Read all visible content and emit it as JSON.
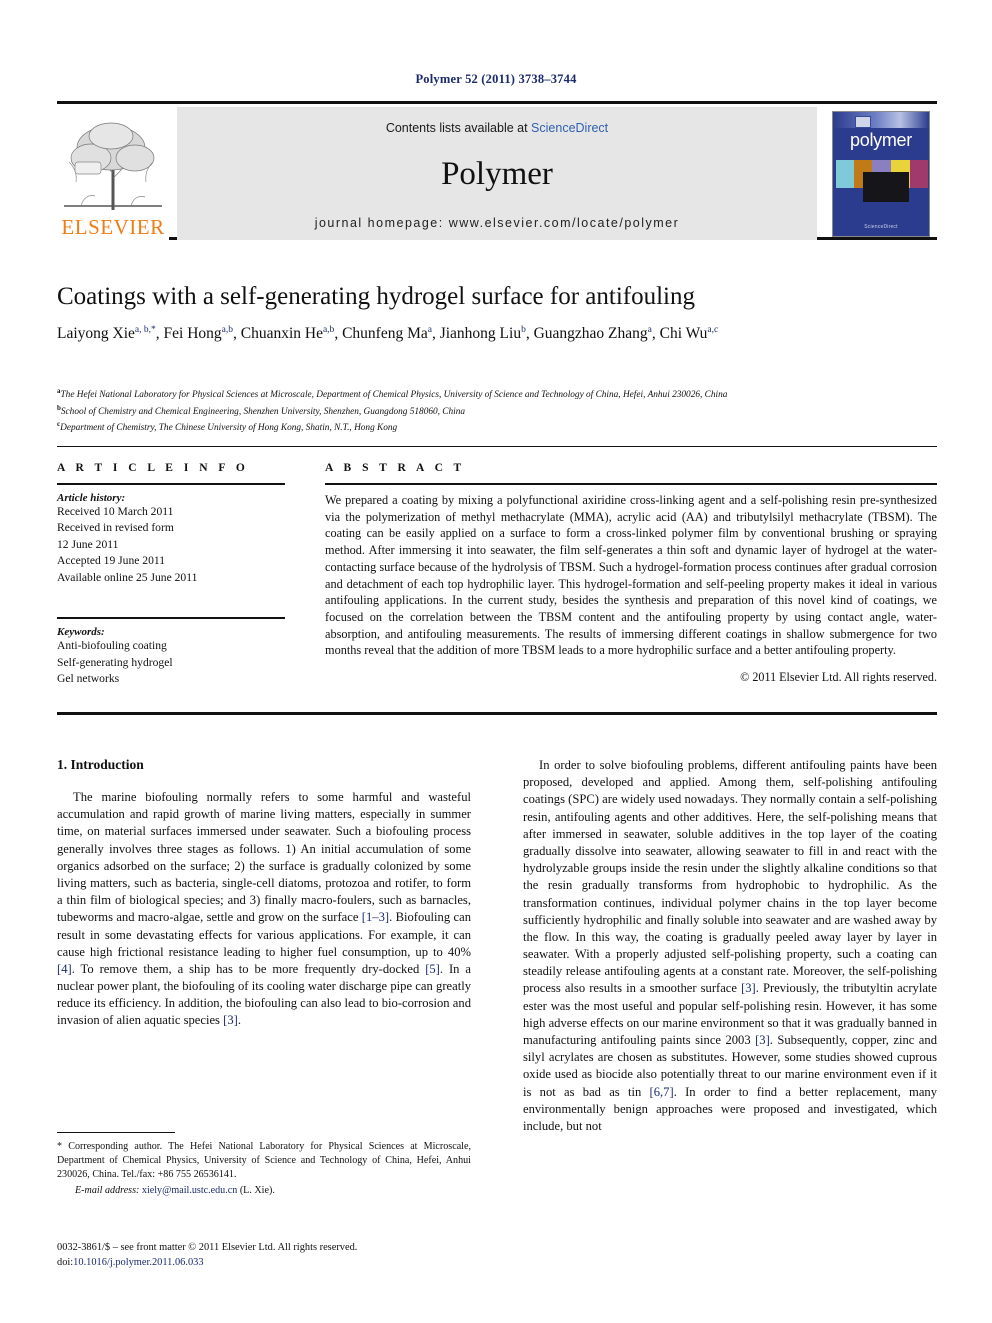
{
  "running_head": "Polymer 52 (2011) 3738–3744",
  "masthead": {
    "publisher": "ELSEVIER",
    "contents_prefix": "Contents lists available at ",
    "contents_link": "ScienceDirect",
    "journal_title": "Polymer",
    "homepage": "journal homepage: www.elsevier.com/locate/polymer",
    "cover_name": "polymer",
    "cover_footer": "ScienceDirect",
    "link_color": "#2f5fb0",
    "elsevier_orange": "#f07c15"
  },
  "article": {
    "title": "Coatings with a self-generating hydrogel surface for antifouling",
    "authors": [
      {
        "name": "Laiyong Xie",
        "sup": "a, b,*"
      },
      {
        "name": "Fei Hong",
        "sup": "a,b"
      },
      {
        "name": "Chuanxin He",
        "sup": "a,b"
      },
      {
        "name": "Chunfeng Ma",
        "sup": "a"
      },
      {
        "name": "Jianhong Liu",
        "sup": "b"
      },
      {
        "name": "Guangzhao Zhang",
        "sup": "a"
      },
      {
        "name": "Chi Wu",
        "sup": "a,c"
      }
    ],
    "affiliations": [
      {
        "marker": "a",
        "text": "The Hefei National Laboratory for Physical Sciences at Microscale, Department of Chemical Physics, University of Science and Technology of China, Hefei, Anhui 230026, China"
      },
      {
        "marker": "b",
        "text": "School of Chemistry and Chemical Engineering, Shenzhen University, Shenzhen, Guangdong 518060, China"
      },
      {
        "marker": "c",
        "text": "Department of Chemistry, The Chinese University of Hong Kong, Shatin, N.T., Hong Kong"
      }
    ]
  },
  "article_info": {
    "heading": "A R T I C L E   I N F O",
    "history_label": "Article history:",
    "history": [
      "Received 10 March 2011",
      "Received in revised form",
      "12 June 2011",
      "Accepted 19 June 2011",
      "Available online 25 June 2011"
    ],
    "keywords_label": "Keywords:",
    "keywords": [
      "Anti-biofouling coating",
      "Self-generating hydrogel",
      "Gel networks"
    ]
  },
  "abstract": {
    "heading": "A B S T R A C T",
    "text": "We prepared a coating by mixing a polyfunctional axiridine cross-linking agent and a self-polishing resin pre-synthesized via the polymerization of methyl methacrylate (MMA), acrylic acid (AA) and tributylsilyl methacrylate (TBSM). The coating can be easily applied on a surface to form a cross-linked polymer film by conventional brushing or spraying method. After immersing it into seawater, the film self-generates a thin soft and dynamic layer of hydrogel at the water-contacting surface because of the hydrolysis of TBSM. Such a hydrogel-formation process continues after gradual corrosion and detachment of each top hydrophilic layer. This hydrogel-formation and self-peeling property makes it ideal in various antifouling applications. In the current study, besides the synthesis and preparation of this novel kind of coatings, we focused on the correlation between the TBSM content and the antifouling property by using contact angle, water-absorption, and antifouling measurements. The results of immersing different coatings in shallow submergence for two months reveal that the addition of more TBSM leads to a more hydrophilic surface and a better antifouling property.",
    "copyright": "© 2011 Elsevier Ltd. All rights reserved."
  },
  "body": {
    "section_heading": "1. Introduction",
    "left_paragraphs": [
      "The marine biofouling normally refers to some harmful and wasteful accumulation and rapid growth of marine living matters, especially in summer time, on material surfaces immersed under seawater. Such a biofouling process generally involves three stages as follows. 1) An initial accumulation of some organics adsorbed on the surface; 2) the surface is gradually colonized by some living matters, such as bacteria, single-cell diatoms, protozoa and rotifer, to form a thin film of biological species; and 3) finally macro-foulers, such as barnacles, tubeworms and macro-algae, settle and grow on the surface [1–3]. Biofouling can result in some devastating effects for various applications. For example, it can cause high frictional resistance leading to higher fuel consumption, up to 40% [4]. To remove them, a ship has to be more frequently dry-docked [5]. In a nuclear power plant, the biofouling of its cooling water discharge pipe can greatly reduce its efficiency. In addition, the biofouling can also lead to bio-corrosion and invasion of alien aquatic species [3]."
    ],
    "right_paragraphs": [
      "In order to solve biofouling problems, different antifouling paints have been proposed, developed and applied. Among them, self-polishing antifouling coatings (SPC) are widely used nowadays. They normally contain a self-polishing resin, antifouling agents and other additives. Here, the self-polishing means that after immersed in seawater, soluble additives in the top layer of the coating gradually dissolve into seawater, allowing seawater to fill in and react with the hydrolyzable groups inside the resin under the slightly alkaline conditions so that the resin gradually transforms from hydrophobic to hydrophilic. As the transformation continues, individual polymer chains in the top layer become sufficiently hydrophilic and finally soluble into seawater and are washed away by the flow. In this way, the coating is gradually peeled away layer by layer in seawater. With a properly adjusted self-polishing property, such a coating can steadily release antifouling agents at a constant rate. Moreover, the self-polishing process also results in a smoother surface [3]. Previously, the tributyltin acrylate ester was the most useful and popular self-polishing resin. However, it has some high adverse effects on our marine environment so that it was gradually banned in manufacturing antifouling paints since 2003 [3]. Subsequently, copper, zinc and silyl acrylates are chosen as substitutes. However, some studies showed cuprous oxide used as biocide also potentially threat to our marine environment even if it is not as bad as tin [6,7]. In order to find a better replacement, many environmentally benign approaches were proposed and investigated, which include, but not"
    ]
  },
  "footnote": {
    "corresponding": "* Corresponding author. The Hefei National Laboratory for Physical Sciences at Microscale, Department of Chemical Physics, University of Science and Technology of China, Hefei, Anhui 230026, China. Tel./fax: +86 755 26536141.",
    "email_label": "E-mail address:",
    "email": "xiely@mail.ustc.edu.cn",
    "email_owner": "(L. Xie)."
  },
  "issn": {
    "line1": "0032-3861/$ – see front matter © 2011 Elsevier Ltd. All rights reserved.",
    "doi_label": "doi:",
    "doi": "10.1016/j.polymer.2011.06.033"
  }
}
